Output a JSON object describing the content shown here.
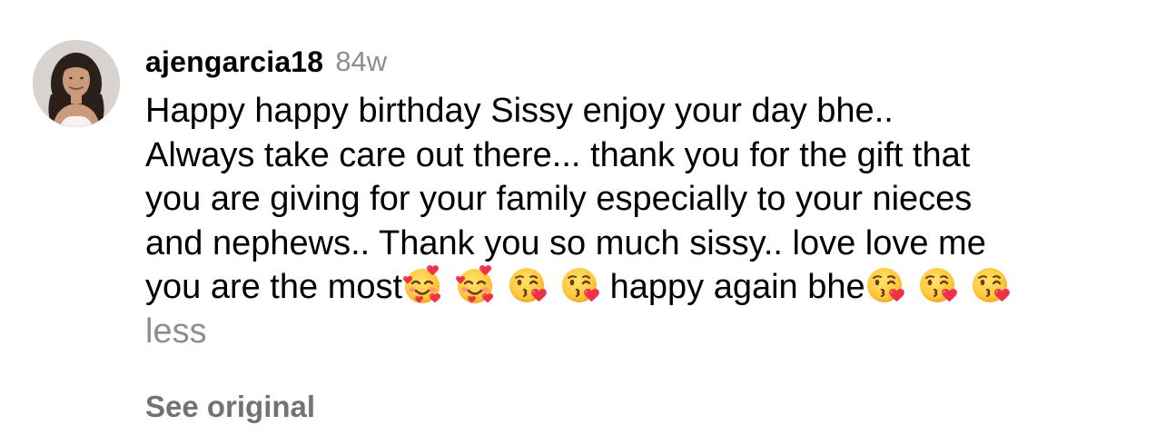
{
  "comment": {
    "username": "ajengarcia18",
    "timestamp": "84w",
    "avatar_icon": "profile-avatar",
    "text_lines": [
      "Happy happy birthday Sissy enjoy your day bhe..",
      "Always take care out there... thank you for the gift that",
      "you are giving for your family especially to your nieces",
      "and nephews.. Thank you so much sissy.. love love me"
    ],
    "last_line": {
      "prefix": "you are the most",
      "middle": " happy again bhe"
    },
    "emojis": {
      "group_1": [
        "smiling-face-with-hearts",
        "smiling-face-with-hearts",
        "face-blowing-a-kiss",
        "face-blowing-a-kiss"
      ],
      "group_2": [
        "face-blowing-a-kiss",
        "face-blowing-a-kiss",
        "face-blowing-a-kiss"
      ]
    },
    "less_label": "less",
    "see_original_label": "See original"
  },
  "colors": {
    "text": "#000000",
    "secondary": "#8e8e8e",
    "link": "#737373",
    "emoji_face": "#ffc83d",
    "heart": "#f0304a"
  }
}
